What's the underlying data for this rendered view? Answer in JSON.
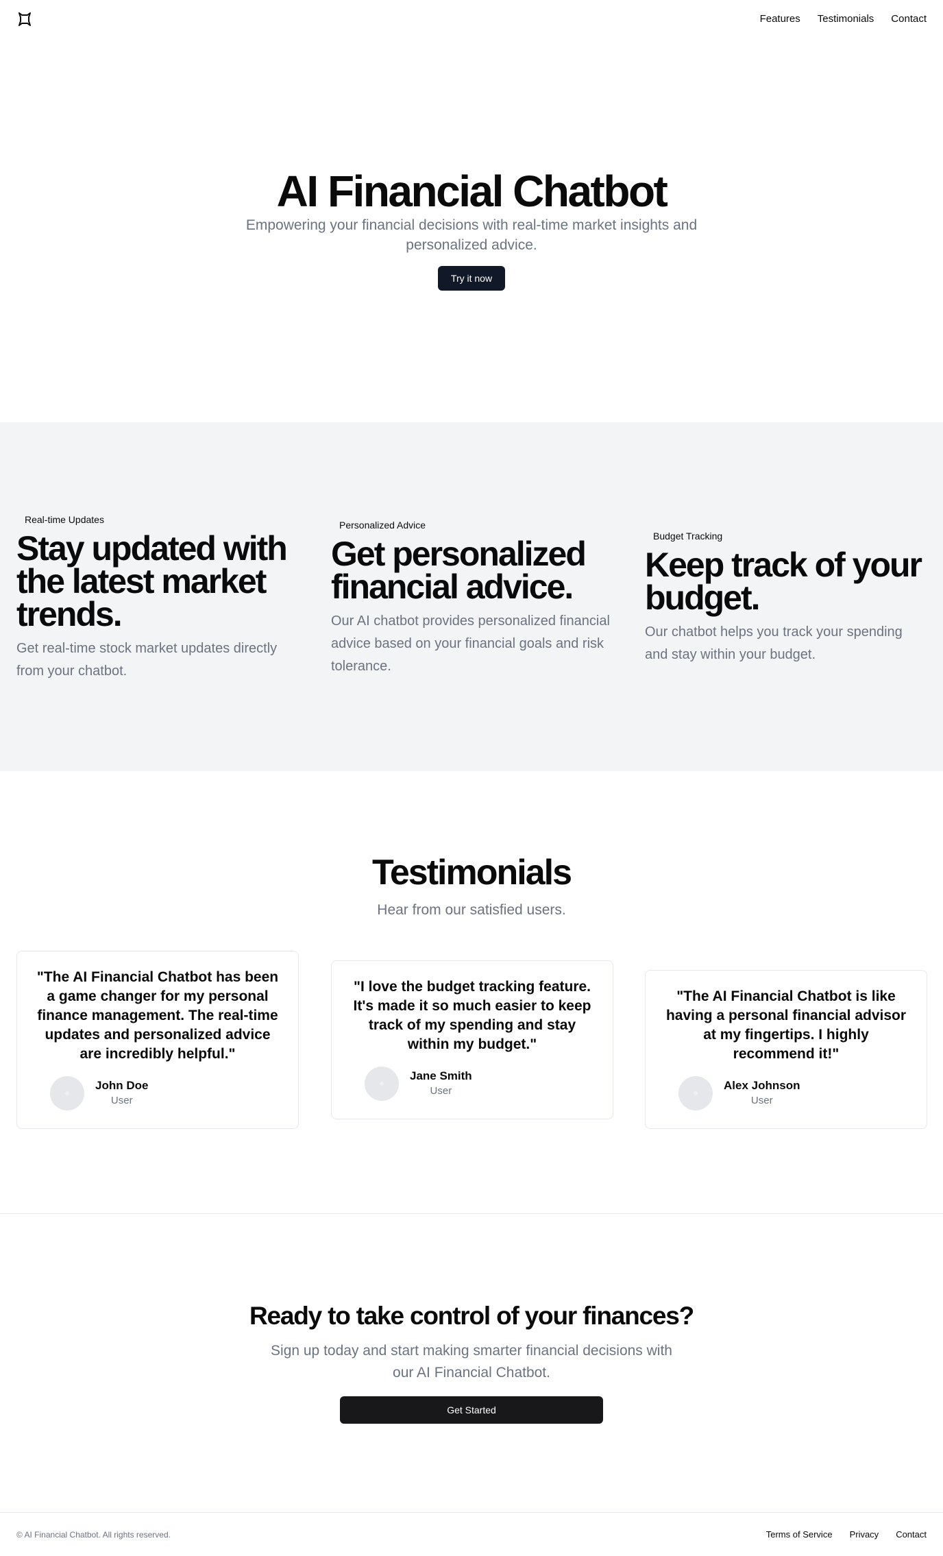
{
  "header": {
    "logo_icon": "mountain-icon",
    "nav": [
      {
        "label": "Features"
      },
      {
        "label": "Testimonials"
      },
      {
        "label": "Contact"
      }
    ]
  },
  "hero": {
    "title": "AI Financial Chatbot",
    "subtitle": "Empowering your financial decisions with real-time market insights and personalized advice.",
    "cta_label": "Try it now"
  },
  "features": [
    {
      "tag": "Real-time Updates",
      "title": "Stay updated with the latest market trends.",
      "description": "Get real-time stock market updates directly from your chatbot."
    },
    {
      "tag": "Personalized Advice",
      "title": "Get personalized financial advice.",
      "description": "Our AI chatbot provides personalized financial advice based on your financial goals and risk tolerance."
    },
    {
      "tag": "Budget Tracking",
      "title": "Keep track of your budget.",
      "description": "Our chatbot helps you track your spending and stay within your budget."
    }
  ],
  "testimonials": {
    "title": "Testimonials",
    "subtitle": "Hear from our satisfied users.",
    "items": [
      {
        "quote": "\"The AI Financial Chatbot has been a game changer for my personal finance management. The real-time updates and personalized advice are incredibly helpful.\"",
        "name": "John Doe",
        "role": "User"
      },
      {
        "quote": "\"I love the budget tracking feature. It's made it so much easier to keep track of my spending and stay within my budget.\"",
        "name": "Jane Smith",
        "role": "User"
      },
      {
        "quote": "\"The AI Financial Chatbot is like having a personal financial advisor at my fingertips. I highly recommend it!\"",
        "name": "Alex Johnson",
        "role": "User"
      }
    ]
  },
  "cta": {
    "title": "Ready to take control of your finances?",
    "subtitle": "Sign up today and start making smarter financial decisions with our AI Financial Chatbot.",
    "button_label": "Get Started"
  },
  "footer": {
    "copyright": "© AI Financial Chatbot. All rights reserved.",
    "links": [
      {
        "label": "Terms of Service"
      },
      {
        "label": "Privacy"
      },
      {
        "label": "Contact"
      }
    ]
  },
  "colors": {
    "primary_button": "#111827",
    "muted_text": "#6b7280",
    "features_bg": "#f3f4f6",
    "border": "#e5e7eb"
  }
}
